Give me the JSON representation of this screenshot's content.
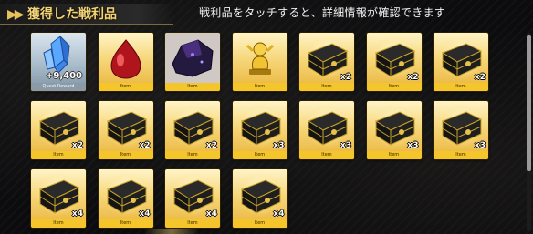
{
  "header": {
    "title": "獲得した戦利品",
    "hint": "戦利品をタッチすると、詳細情報が確認できます"
  },
  "items": [
    {
      "kind": "crystal",
      "frame": "silver",
      "label": "Quest Reward",
      "amount": "+9,400",
      "qty": ""
    },
    {
      "kind": "red-drop",
      "frame": "gold",
      "label": "Item",
      "amount": "",
      "qty": ""
    },
    {
      "kind": "dark-gem",
      "frame": "gold",
      "label": "Item",
      "amount": "",
      "qty": ""
    },
    {
      "kind": "gold-statue",
      "frame": "gold",
      "label": "Item",
      "amount": "",
      "qty": ""
    },
    {
      "kind": "chest",
      "frame": "gold",
      "label": "Item",
      "amount": "",
      "qty": "x2"
    },
    {
      "kind": "chest",
      "frame": "gold",
      "label": "Item",
      "amount": "",
      "qty": "x2"
    },
    {
      "kind": "chest",
      "frame": "gold",
      "label": "Item",
      "amount": "",
      "qty": "x2"
    },
    {
      "kind": "chest",
      "frame": "gold",
      "label": "Item",
      "amount": "",
      "qty": "x2"
    },
    {
      "kind": "chest",
      "frame": "gold",
      "label": "Item",
      "amount": "",
      "qty": "x2"
    },
    {
      "kind": "chest",
      "frame": "gold",
      "label": "Item",
      "amount": "",
      "qty": "x2"
    },
    {
      "kind": "chest",
      "frame": "gold",
      "label": "Item",
      "amount": "",
      "qty": "x3"
    },
    {
      "kind": "chest",
      "frame": "gold",
      "label": "Item",
      "amount": "",
      "qty": "x3"
    },
    {
      "kind": "chest",
      "frame": "gold",
      "label": "Item",
      "amount": "",
      "qty": "x3"
    },
    {
      "kind": "chest",
      "frame": "gold",
      "label": "Item",
      "amount": "",
      "qty": "x3"
    },
    {
      "kind": "chest",
      "frame": "gold",
      "label": "Item",
      "amount": "",
      "qty": "x4"
    },
    {
      "kind": "chest",
      "frame": "gold",
      "label": "Item",
      "amount": "",
      "qty": "x4"
    },
    {
      "kind": "chest",
      "frame": "gold",
      "label": "Item",
      "amount": "",
      "qty": "x4"
    },
    {
      "kind": "chest",
      "frame": "gold",
      "label": "Item",
      "amount": "",
      "qty": "x4"
    }
  ]
}
